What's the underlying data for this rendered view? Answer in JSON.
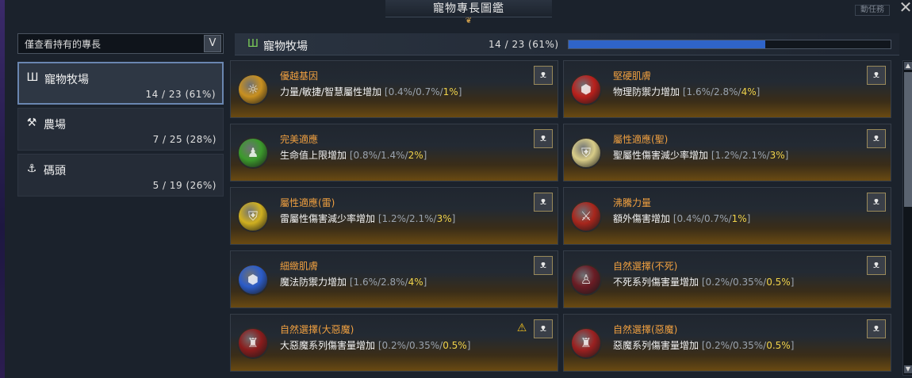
{
  "window": {
    "title": "寵物專長圖鑑",
    "topright_tag": "動任務",
    "close_glyph": "✕"
  },
  "filter": {
    "label": "僅查看持有的專長",
    "chevron": "V"
  },
  "categories": [
    {
      "icon": "Ш",
      "name": "寵物牧場",
      "count": "14 / 23 (61%)"
    },
    {
      "icon": "⚒",
      "name": "農場",
      "count": "7 / 25 (28%)"
    },
    {
      "icon": "⚓",
      "name": "碼頭",
      "count": "5 / 19 (26%)"
    }
  ],
  "section": {
    "icon": "Ш",
    "name": "寵物牧場",
    "progress_text": "14 / 23 (61%)",
    "progress_fraction": 0.61
  },
  "cards": [
    {
      "name": "優越基因",
      "desc": "力量/敏捷/智慧屬性增加",
      "lo": "0.4%/0.7%/",
      "hi": "1%",
      "orb_color": "#c89020",
      "orb_glyph": "☼",
      "pet": "ᴥ",
      "warn": false
    },
    {
      "name": "堅硬肌膚",
      "desc": "物理防禦力增加",
      "lo": "1.6%/2.8%/",
      "hi": "4%",
      "orb_color": "#b8201c",
      "orb_glyph": "⬢",
      "pet": "ᴥ",
      "warn": false
    },
    {
      "name": "完美適應",
      "desc": "生命值上限增加",
      "lo": "0.8%/1.4%/",
      "hi": "2%",
      "orb_color": "#3c9a2c",
      "orb_glyph": "♟",
      "pet": "ᴥ",
      "warn": false
    },
    {
      "name": "屬性適應(聖)",
      "desc": "聖屬性傷害減少率增加",
      "lo": "1.2%/2.1%/",
      "hi": "3%",
      "orb_color": "#d8cc88",
      "orb_glyph": "⛨",
      "pet": "ᴥ",
      "warn": false
    },
    {
      "name": "屬性適應(雷)",
      "desc": "雷屬性傷害減少率增加",
      "lo": "1.2%/2.1%/",
      "hi": "3%",
      "orb_color": "#d0b020",
      "orb_glyph": "⛨",
      "pet": "ᴥ",
      "warn": false
    },
    {
      "name": "沸騰力量",
      "desc": "額外傷害增加",
      "lo": "0.4%/0.7%/",
      "hi": "1%",
      "orb_color": "#a8261c",
      "orb_glyph": "⚔",
      "pet": "ᴥ",
      "warn": false
    },
    {
      "name": "細緻肌膚",
      "desc": "魔法防禦力增加",
      "lo": "1.6%/2.8%/",
      "hi": "4%",
      "orb_color": "#2c5cc8",
      "orb_glyph": "⬢",
      "pet": "ᴥ",
      "warn": false
    },
    {
      "name": "自然選擇(不死)",
      "desc": "不死系列傷害量增加",
      "lo": "0.2%/0.35%/",
      "hi": "0.5%",
      "orb_color": "#6a1c24",
      "orb_glyph": "♙",
      "pet": "ᴥ",
      "warn": false
    },
    {
      "name": "自然選擇(大惡魔)",
      "desc": "大惡魔系列傷害量增加",
      "lo": "0.2%/0.35%/",
      "hi": "0.5%",
      "orb_color": "#8a1c1c",
      "orb_glyph": "♜",
      "pet": "ᴥ",
      "warn": true,
      "warn_glyph": "⚠"
    },
    {
      "name": "自然選擇(惡魔)",
      "desc": "惡魔系列傷害量增加",
      "lo": "0.2%/0.35%/",
      "hi": "0.5%",
      "orb_color": "#9a2020",
      "orb_glyph": "♜",
      "pet": "ᴥ",
      "warn": false
    }
  ],
  "scroll": {
    "up": "▲",
    "down": "▼"
  }
}
